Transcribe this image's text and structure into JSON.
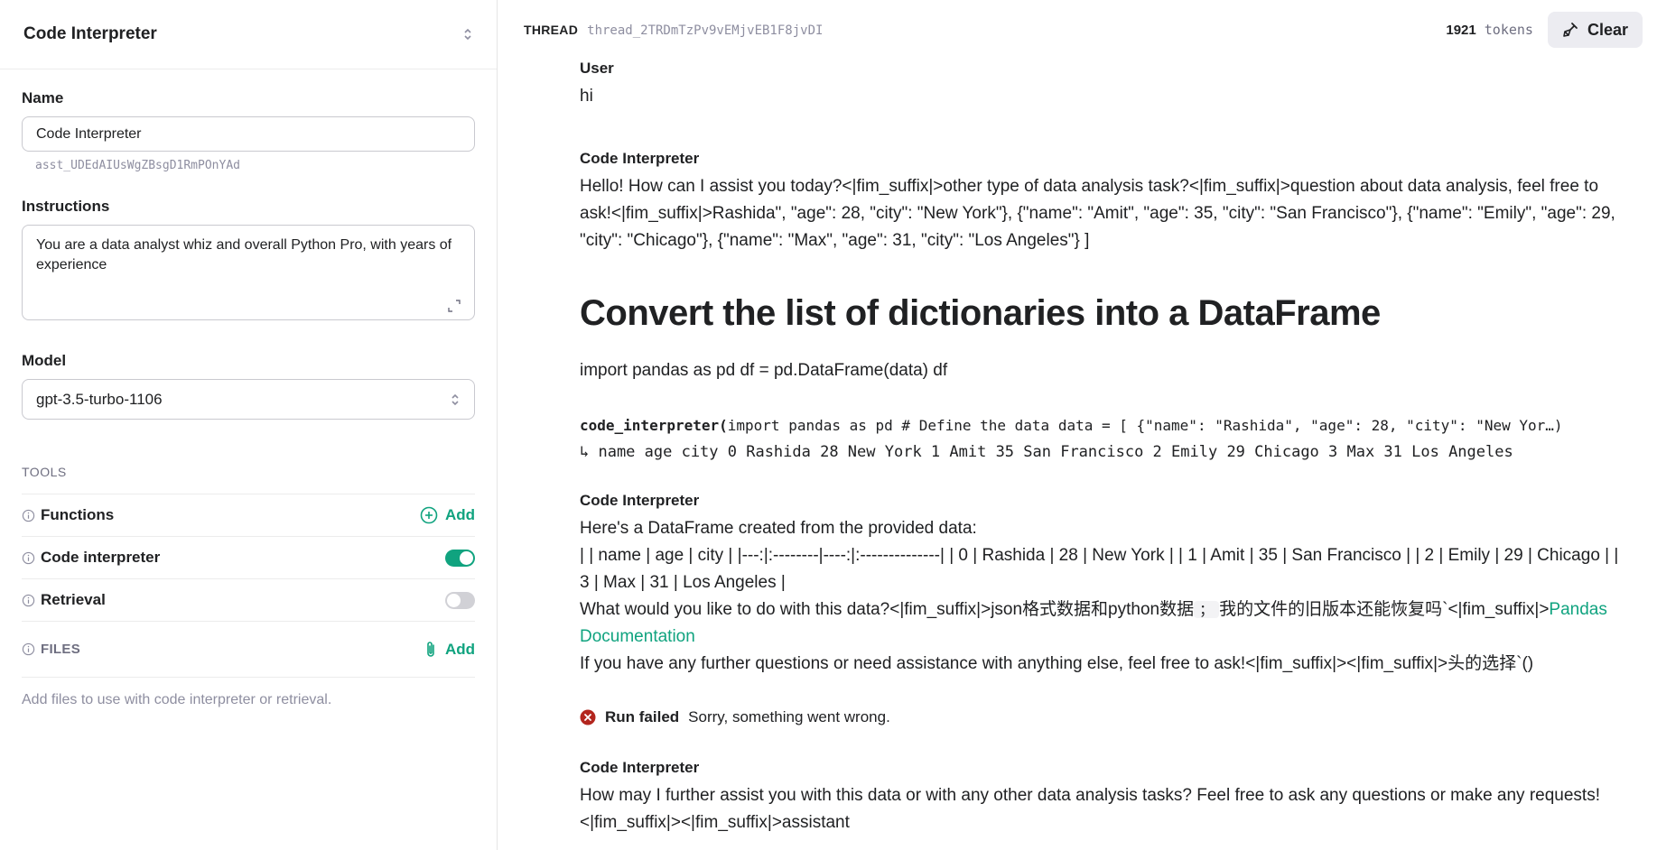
{
  "sidebar": {
    "title": "Code Interpreter",
    "name_label": "Name",
    "name_value": "Code Interpreter",
    "assistant_id": "asst_UDEdAIUsWgZBsgD1RmPOnYAd",
    "instructions_label": "Instructions",
    "instructions_value": "You are a data analyst whiz and overall Python Pro, with years of experience",
    "model_label": "Model",
    "model_value": "gpt-3.5-turbo-1106",
    "tools_heading": "TOOLS",
    "tools": [
      {
        "label": "Functions",
        "control": "add",
        "add_label": "Add"
      },
      {
        "label": "Code interpreter",
        "control": "toggle",
        "enabled": true
      },
      {
        "label": "Retrieval",
        "control": "toggle",
        "enabled": false
      }
    ],
    "files_label": "FILES",
    "files_add_label": "Add",
    "files_hint": "Add files to use with code interpreter or retrieval."
  },
  "thread": {
    "label": "THREAD",
    "id": "thread_2TRDmTzPv9vEMjvEB1F8jvDI",
    "tokens_count": "1921",
    "tokens_label": "tokens",
    "clear_label": "Clear"
  },
  "messages": {
    "m1": {
      "role": "User",
      "text": "hi"
    },
    "m2": {
      "role": "Code Interpreter",
      "text": "Hello! How can I assist you today?<|fim_suffix|>other type of data analysis task?<|fim_suffix|>question about data analysis, feel free to ask!<|fim_suffix|>Rashida\", \"age\": 28, \"city\": \"New York\"}, {\"name\": \"Amit\", \"age\": 35, \"city\": \"San Francisco\"}, {\"name\": \"Emily\", \"age\": 29, \"city\": \"Chicago\"}, {\"name\": \"Max\", \"age\": 31, \"city\": \"Los Angeles\"} ]",
      "heading": "Convert the list of dictionaries into a DataFrame",
      "after_heading": "import pandas as pd df = pd.DataFrame(data) df",
      "code_fn": "code_interpreter(",
      "code_args": "import pandas as pd  # Define the data data = [ {\"name\": \"Rashida\", \"age\": 28, \"city\": \"New Yor…)",
      "code_output": "↳ name age city 0 Rashida 28 New York 1 Amit 35 San Francisco 2 Emily 29 Chicago 3 Max 31 Los Angeles"
    },
    "m3": {
      "role": "Code Interpreter",
      "line1": "Here's a DataFrame created from the provided data:",
      "line2": "| | name | age | city | |---:|:--------|----:|:--------------| | 0 | Rashida | 28 | New York | | 1 | Amit | 35 | San Francisco | | 2 | Emily | 29 | Chicago | | 3 | Max | 31 | Los Angeles |",
      "line3_pre": "What would you like to do with this data?<|fim_suffix|>json格式数据和python数据",
      "line3_code": "；",
      "line3_mid": "我的文件的旧版本还能恢复吗`<|fim_suffix|>",
      "link_text": "Pandas Documentation",
      "line4": "If you have any further questions or need assistance with anything else, feel free to ask!<|fim_suffix|><|fim_suffix|>头的选择`()"
    },
    "error": {
      "title": "Run failed",
      "text": "Sorry, something went wrong."
    },
    "m4": {
      "role": "Code Interpreter",
      "text": "How may I further assist you with this data or with any other data analysis tasks? Feel free to ask any questions or make any requests!<|fim_suffix|><|fim_suffix|>assistant"
    }
  },
  "colors": {
    "accent": "#10a37f",
    "error": "#c0392b",
    "border": "#c9c9cf"
  }
}
